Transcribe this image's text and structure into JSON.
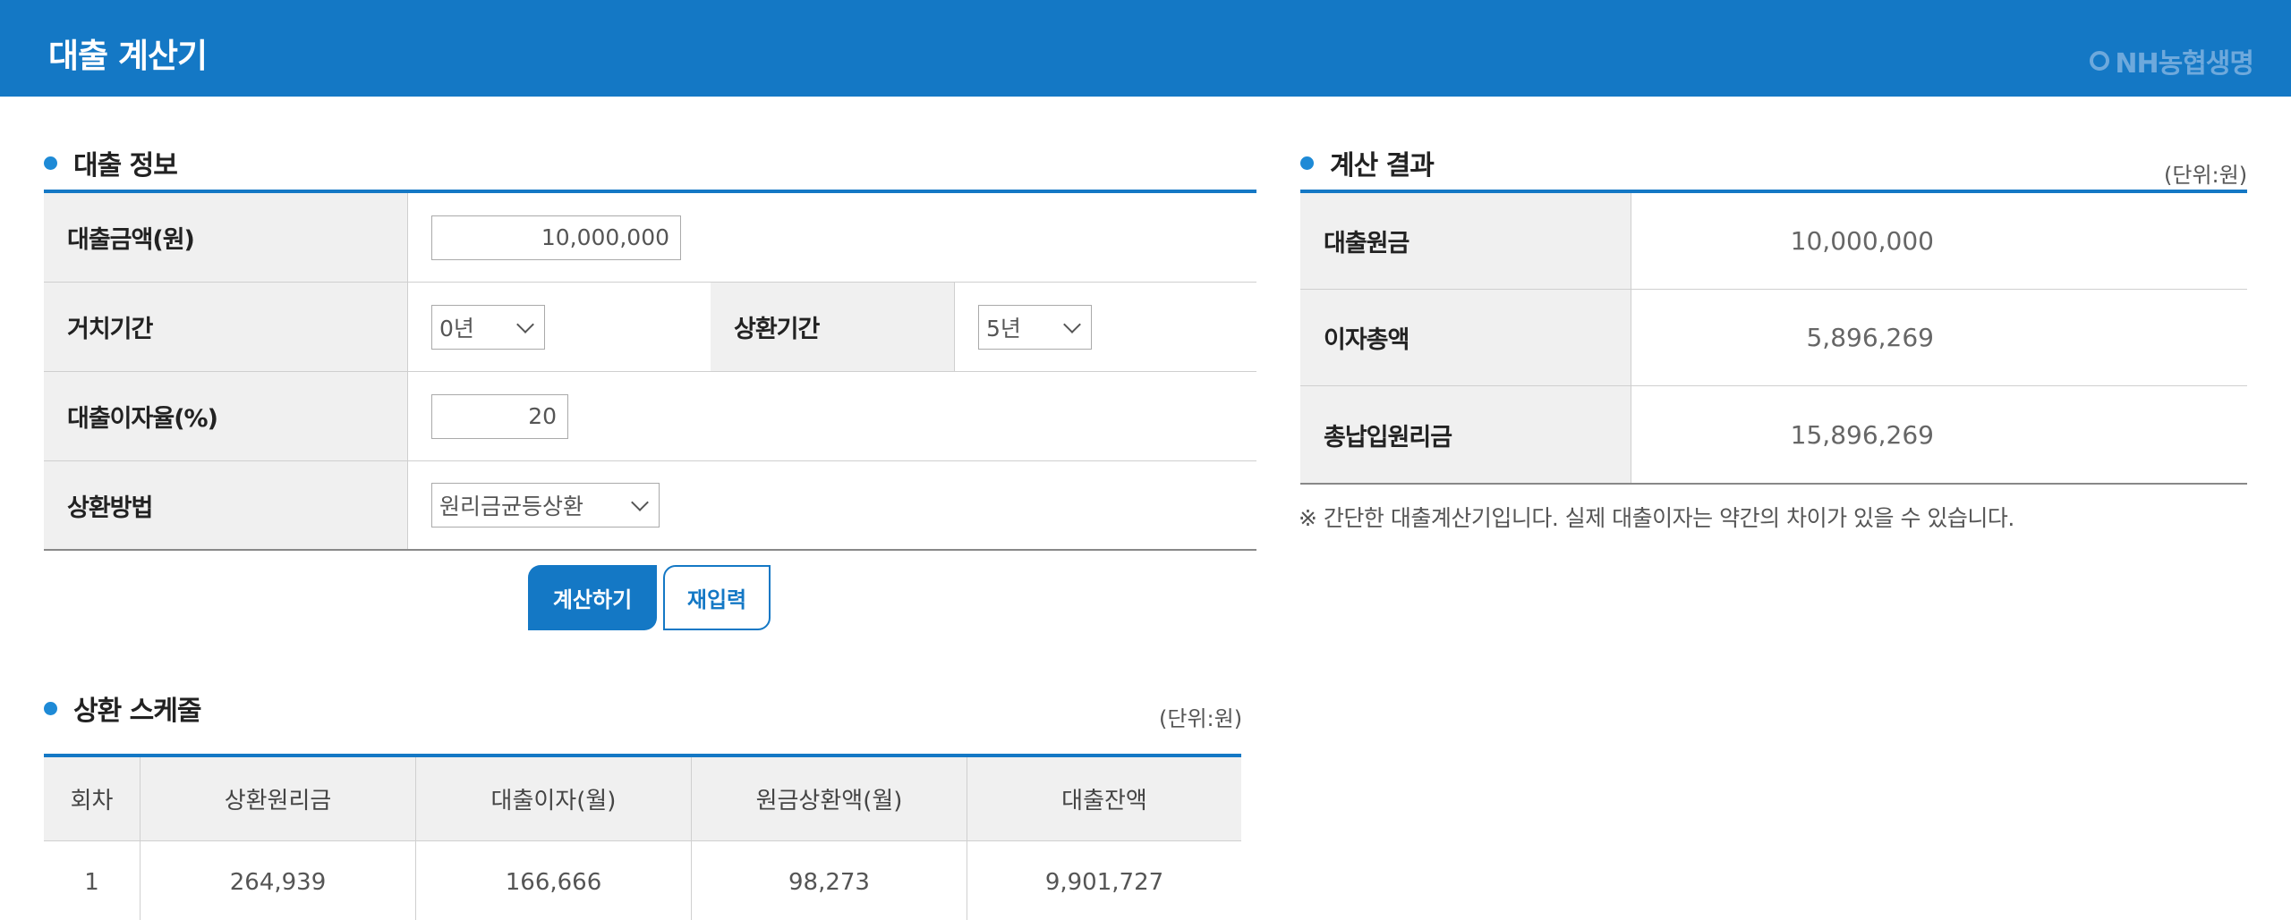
{
  "header": {
    "title": "대출 계산기",
    "brand": "NH농협생명"
  },
  "loan_info": {
    "section_title": "대출 정보",
    "amount_label": "대출금액(원)",
    "amount_value": "10,000,000",
    "grace_label": "거치기간",
    "grace_value": "0년",
    "repay_period_label": "상환기간",
    "repay_period_value": "5년",
    "rate_label": "대출이자율(%)",
    "rate_value": "20",
    "method_label": "상환방법",
    "method_value": "원리금균등상환"
  },
  "buttons": {
    "calculate": "계산하기",
    "reset": "재입력"
  },
  "schedule": {
    "section_title": "상환 스케줄",
    "unit": "(단위:원)",
    "columns": [
      "회차",
      "상환원리금",
      "대출이자(월)",
      "원금상환액(월)",
      "대출잔액"
    ],
    "rows": [
      [
        "1",
        "264,939",
        "166,666",
        "98,273",
        "9,901,727"
      ]
    ]
  },
  "result": {
    "section_title": "계산 결과",
    "unit": "(단위:원)",
    "rows": [
      {
        "label": "대출원금",
        "value": "10,000,000"
      },
      {
        "label": "이자총액",
        "value": "5,896,269"
      },
      {
        "label": "총납입원리금",
        "value": "15,896,269"
      }
    ],
    "note": "※ 간단한 대출계산기입니다. 실제 대출이자는 약간의 차이가 있을 수 있습니다."
  }
}
